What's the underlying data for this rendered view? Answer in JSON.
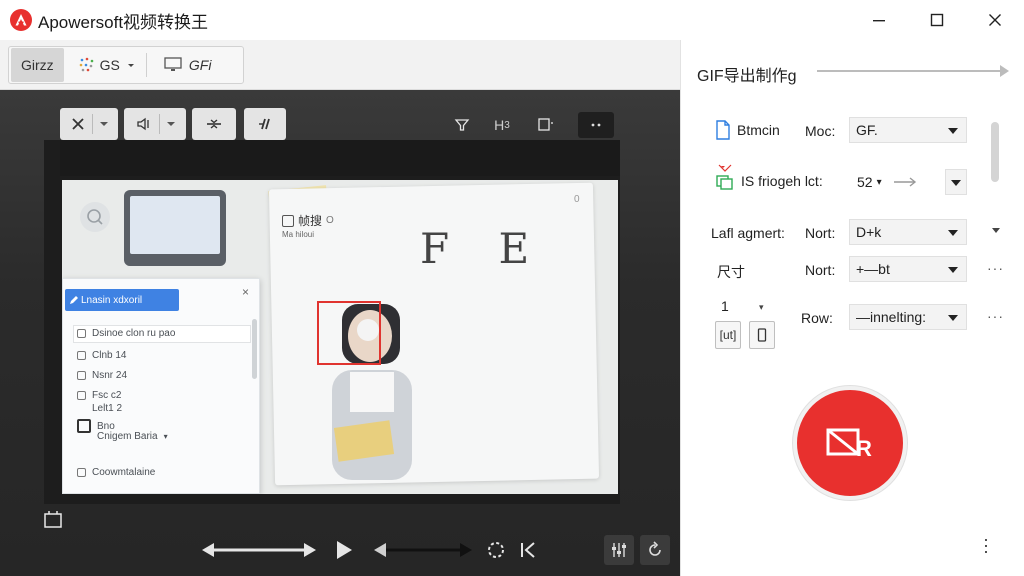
{
  "window": {
    "title": "Apowersoft视频转换王",
    "colors": {
      "accent": "#e8302e",
      "panel_dark": "#2c2c2c"
    }
  },
  "tabs": [
    {
      "label": "Girzz",
      "icon": null,
      "active": true
    },
    {
      "label": "GS",
      "icon": "dots-grid-icon",
      "active": false
    },
    {
      "label": "GFi",
      "icon": "monitor-icon",
      "active": false
    }
  ],
  "preview": {
    "face_label": "帧搜",
    "face_label_suffix": "O",
    "face_sub": "Ma hiloui",
    "big_letters": "F E",
    "dialog": {
      "button_label": "Lnasin xdxoril",
      "rows": [
        "Dsinoe clon ru pao",
        "Clnb 14",
        "Nsnr 24",
        "Fsc c2",
        "Lelt1 2",
        "Bno",
        "Cnigem Baria",
        "Coowmtalaine"
      ]
    }
  },
  "panel": {
    "title": "GIF导出制作g",
    "rows": [
      {
        "label": "Btmcin",
        "sub": "Moc:",
        "value": "GF."
      },
      {
        "label": "IS friogeh lct:",
        "value": "52"
      },
      {
        "label": "Lafl agmert:",
        "sub": "Nort:",
        "value": "D+k"
      },
      {
        "label": "尺寸",
        "sub": "Nort:",
        "value": "+—bt"
      },
      {
        "label": "1",
        "sub": "Row:",
        "value": "—innelting:"
      }
    ],
    "small_box_label": "[ut]"
  },
  "icons": {
    "logo": "app-logo-icon",
    "record": "record-icon"
  }
}
